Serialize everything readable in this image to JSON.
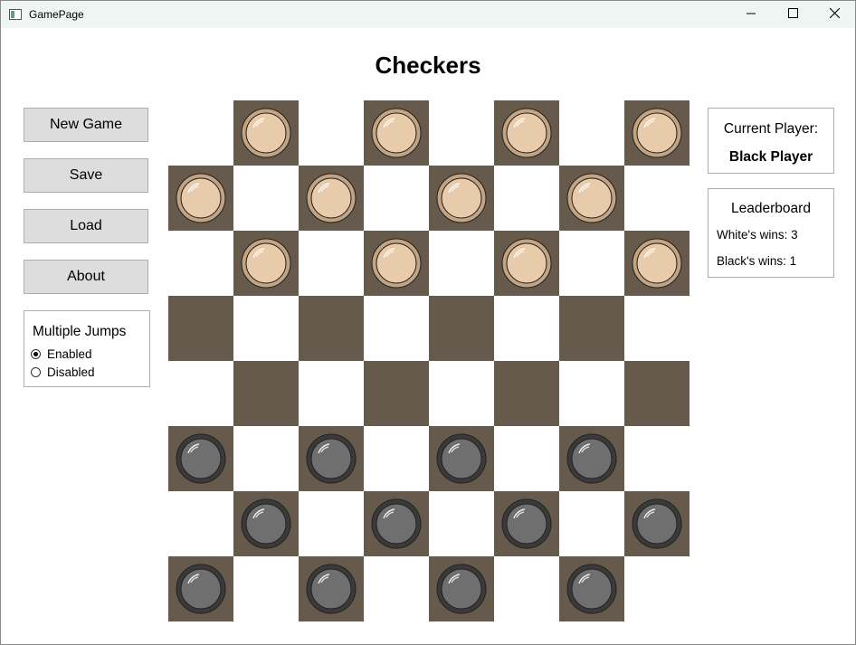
{
  "window": {
    "title": "GamePage",
    "controls": [
      "minimize-icon",
      "maximize-icon",
      "close-icon"
    ]
  },
  "heading": "Checkers",
  "buttons": {
    "new_game": "New Game",
    "save": "Save",
    "load": "Load",
    "about": "About"
  },
  "multiple_jumps": {
    "title": "Multiple Jumps",
    "options": [
      "Enabled",
      "Disabled"
    ],
    "selected": "Enabled"
  },
  "current_player": {
    "label": "Current Player:",
    "value": "Black Player"
  },
  "leaderboard": {
    "title": "Leaderboard",
    "white_wins": "White's wins: 3",
    "black_wins": "Black's wins: 1"
  },
  "board": {
    "rows": [
      ". w . w . w . w",
      "w . w . w . w .",
      ". w . w . w . w",
      ". . . . . . . .",
      ". . . . . . . .",
      "b . b . b . b .",
      ". b . b . b . b",
      "b . b . b . b ."
    ],
    "colors": {
      "dark_square": "#655a4b",
      "light_square": "#ffffff",
      "white_piece": "#e8cbaa",
      "white_piece_rim": "#c4a383",
      "black_piece": "#6f6f6f",
      "black_piece_rim": "#3a3a3a"
    }
  }
}
